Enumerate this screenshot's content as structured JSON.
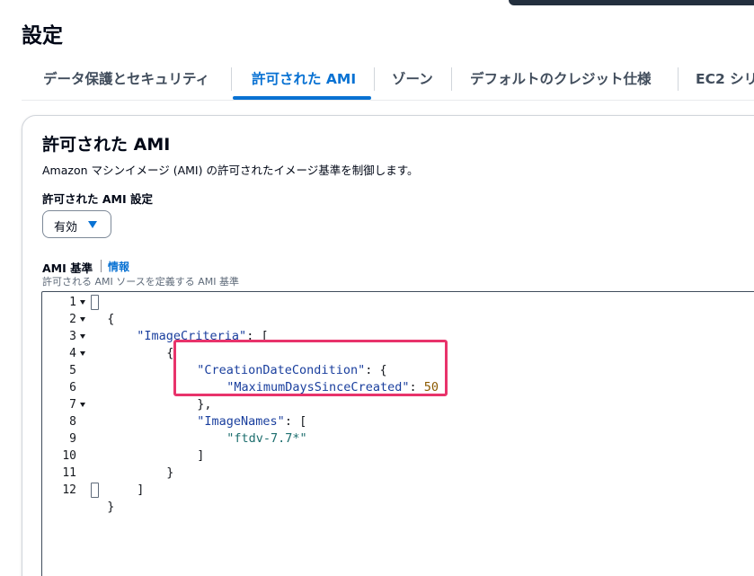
{
  "page": {
    "title": "設定"
  },
  "tabs": [
    {
      "label": "データ保護とセキュリティ",
      "active": false
    },
    {
      "label": "許可された AMI",
      "active": true
    },
    {
      "label": "ゾーン",
      "active": false
    },
    {
      "label": "デフォルトのクレジット仕様",
      "active": false
    },
    {
      "label": "EC2 シリ",
      "active": false
    }
  ],
  "panel": {
    "heading": "許可された AMI",
    "description": "Amazon マシンイメージ (AMI) の許可されたイメージ基準を制御します。",
    "setting_label": "許可された AMI 設定",
    "setting_value": "有効",
    "criteria_label": "AMI 基準",
    "info_link": "情報",
    "criteria_hint": "許可される AMI ソースを定義する AMI 基準"
  },
  "editor": {
    "line_numbers": [
      "1",
      "2",
      "3",
      "4",
      "5",
      "6",
      "7",
      "8",
      "9",
      "10",
      "11",
      "12"
    ],
    "tokens": {
      "l1_open": "{",
      "l2_key": "\"ImageCriteria\"",
      "l2_rest": ": [",
      "l3": "{",
      "l4_key": "\"CreationDateCondition\"",
      "l4_rest": ": {",
      "l5_key": "\"MaximumDaysSinceCreated\"",
      "l5_colon": ": ",
      "l5_value": "50",
      "l6": "},",
      "l7_key": "\"ImageNames\"",
      "l7_rest": ": [",
      "l8_value": "\"ftdv-7.7*\"",
      "l9": "]",
      "l10": "}",
      "l11": "]",
      "l12_close": "}"
    }
  },
  "colors": {
    "accent": "#0972d3",
    "highlight": "#e8336b",
    "json_key": "#1a3f9e",
    "json_string": "#1d6e6e",
    "json_number": "#8c5a00"
  }
}
